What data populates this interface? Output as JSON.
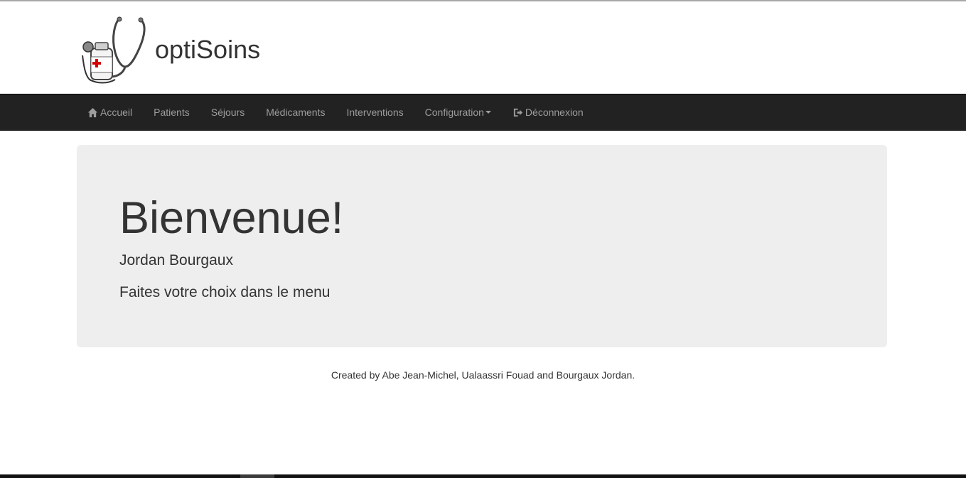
{
  "header": {
    "brand_title": "optiSoins",
    "logo_icon": "stethoscope-medicine-icon"
  },
  "nav": {
    "items": [
      {
        "label": "Accueil",
        "icon": "home-icon"
      },
      {
        "label": "Patients"
      },
      {
        "label": "Séjours"
      },
      {
        "label": "Médicaments"
      },
      {
        "label": "Interventions"
      },
      {
        "label": "Configuration",
        "has_dropdown": true
      },
      {
        "label": "Déconnexion",
        "icon": "logout-icon"
      }
    ]
  },
  "jumbotron": {
    "title": "Bienvenue!",
    "user_name": "Jordan Bourgaux",
    "instruction": "Faites votre choix dans le menu"
  },
  "footer": {
    "credits": "Created by Abe Jean-Michel, Ualaassri Fouad and Bourgaux Jordan."
  },
  "colors": {
    "navbar_bg": "#222222",
    "nav_text": "#9d9d9d",
    "jumbotron_bg": "#eeeeee",
    "text": "#333333",
    "logo_cross": "#d40000"
  }
}
